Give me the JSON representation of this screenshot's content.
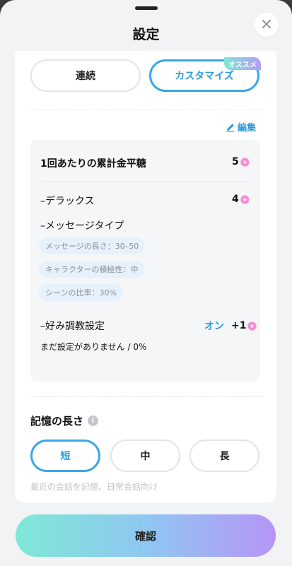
{
  "header": {
    "title": "設定",
    "close_glyph": "✕"
  },
  "mode_tabs": [
    {
      "label": "連続",
      "selected": false
    },
    {
      "label": "カスタマイズ",
      "selected": true,
      "badge": "オススメ"
    }
  ],
  "edit_label": "編集",
  "summary": {
    "total_label": "1回あたりの累計金平糖",
    "total_value": "5",
    "deluxe_label": "–デラックス",
    "deluxe_value": "4",
    "message_type_label": "–メッセージタイプ",
    "chips": [
      "メッセージの長さ：30–50",
      "キャラクターの積極性：中",
      "シーンの比率：30%"
    ],
    "preference_label": "–好み調教設定",
    "preference_status": "オン",
    "preference_value": "+1",
    "preference_note": "まだ設定がありません / 0%"
  },
  "memory": {
    "title": "記憶の長さ",
    "info_glyph": "i",
    "options": [
      {
        "label": "短",
        "selected": true
      },
      {
        "label": "中",
        "selected": false
      },
      {
        "label": "長",
        "selected": false
      }
    ],
    "hint": "最近の会話を記憶、日常会話向け"
  },
  "confirm_label": "確認",
  "colors": {
    "accent": "#2a9bdf",
    "currency": "#f08ad3",
    "chip_bg": "#e6f1fb"
  },
  "icons": {
    "close": "close-icon",
    "edit": "pencil-icon",
    "currency": "konpeito-icon",
    "info": "info-icon"
  }
}
